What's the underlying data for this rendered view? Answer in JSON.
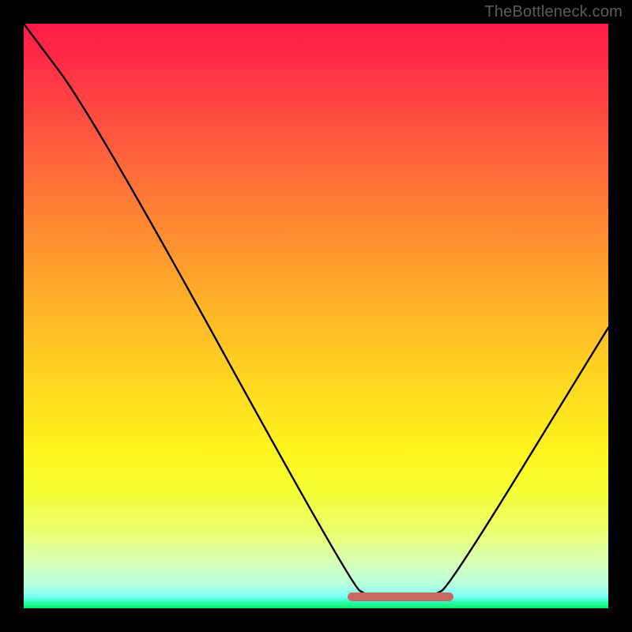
{
  "watermark": "TheBottleneck.com",
  "colors": {
    "segment": "#c66a61",
    "line": "#000000",
    "frame": "#000000"
  },
  "chart_data": {
    "type": "line",
    "title": "",
    "xlabel": "",
    "ylabel": "",
    "xlim": [
      0,
      100
    ],
    "ylim": [
      0,
      100
    ],
    "grid": false,
    "series": [
      {
        "name": "curve",
        "x": [
          0,
          12,
          56,
          59,
          63,
          70,
          73,
          100
        ],
        "y": [
          100,
          84,
          4,
          2,
          1.5,
          2,
          4,
          48
        ]
      }
    ],
    "annotations": [
      {
        "name": "highlight-segment",
        "x_start": 56,
        "x_end": 73,
        "y": 2,
        "color": "#c66a61"
      }
    ]
  }
}
